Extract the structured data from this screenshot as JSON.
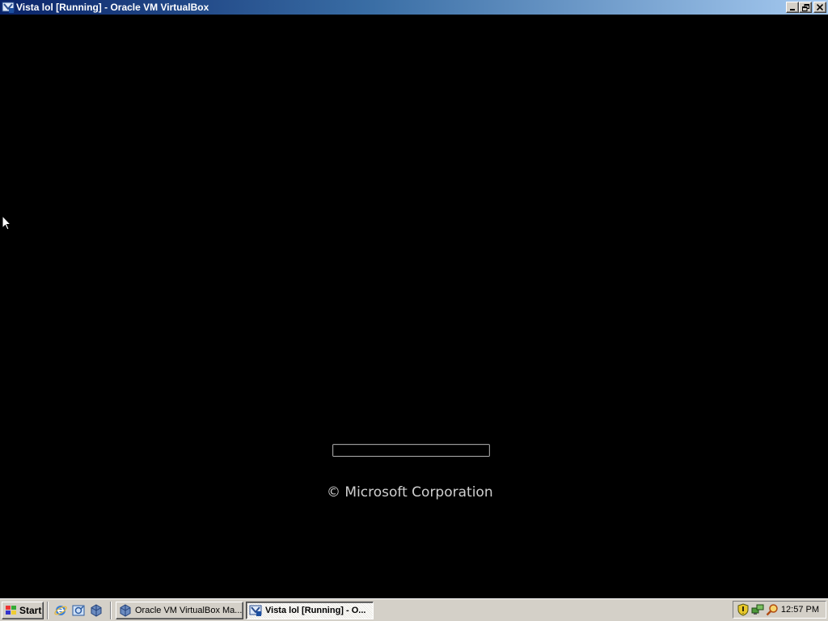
{
  "window": {
    "title": "Vista lol [Running] - Oracle VM VirtualBox",
    "buttons": {
      "minimize": "_",
      "restore": "❐",
      "close": "✕"
    }
  },
  "vm_screen": {
    "copyright": "© Microsoft Corporation",
    "boot_progress": 0
  },
  "taskbar": {
    "start_label": "Start",
    "quick_launch": [
      {
        "icon": "internet-explorer-icon"
      },
      {
        "icon": "outlook-express-icon"
      },
      {
        "icon": "virtualbox-icon"
      }
    ],
    "tasks": [
      {
        "label": "Oracle VM VirtualBox Ma...",
        "icon": "virtualbox-icon",
        "active": false
      },
      {
        "label": "Vista lol [Running] - O...",
        "icon": "virtualbox-vm-icon",
        "active": true
      }
    ],
    "tray": {
      "icons": [
        "security-shield-icon",
        "network-icon",
        "search-icon"
      ],
      "clock": "12:57 PM"
    }
  }
}
